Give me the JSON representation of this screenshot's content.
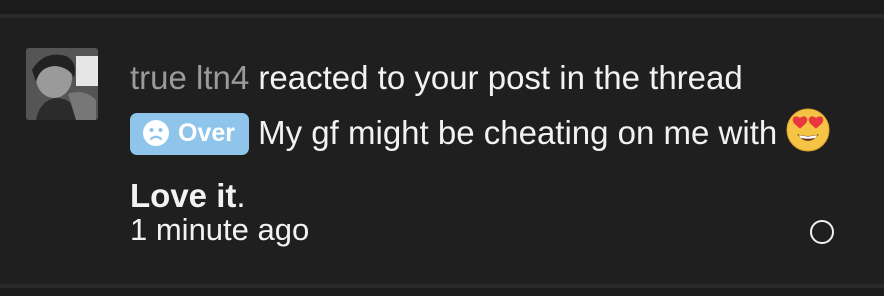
{
  "notification": {
    "username": "true ltn4",
    "action_text": " reacted to your post in the thread ",
    "thread_prefix": {
      "label": "Over",
      "icon": "sad-face-icon",
      "color": "#8fc5ea"
    },
    "thread_title": " My gf might be cheating on me with ",
    "reaction": {
      "emoji": "heart-eyes-emoji-icon",
      "name": "Love it"
    },
    "end_punctuation": ".",
    "time": "1 minute ago",
    "read_toggle_icon": "circle-outline-icon"
  }
}
